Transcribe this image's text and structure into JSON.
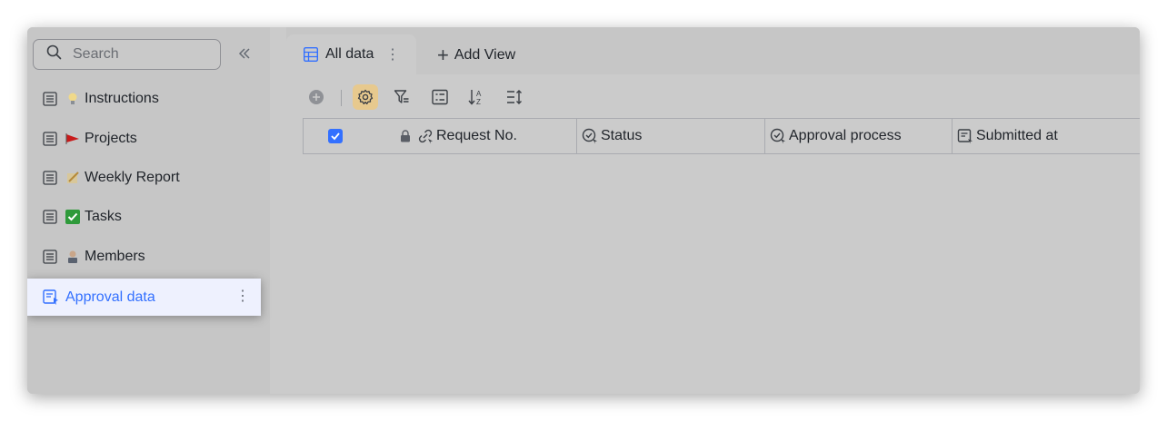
{
  "sidebar": {
    "search": {
      "placeholder": "Search"
    },
    "items": [
      {
        "emoji": "💡",
        "label": "Instructions"
      },
      {
        "emoji": "🚩",
        "label": "Projects"
      },
      {
        "emoji": "📝",
        "label": "Weekly Report"
      },
      {
        "emoji": "✅",
        "label": "Tasks"
      },
      {
        "emoji": "👨‍💻",
        "label": "Members"
      }
    ],
    "active_item": {
      "label": "Approval data"
    }
  },
  "view_tabs": {
    "active_tab": {
      "label": "All data"
    },
    "add_view": {
      "label": "Add View"
    }
  },
  "grid": {
    "columns": [
      {
        "label": "Request No."
      },
      {
        "label": "Status"
      },
      {
        "label": "Approval process"
      },
      {
        "label": "Submitted at"
      }
    ],
    "select_all_checked": true
  },
  "colors": {
    "accent": "#3370ff",
    "active_tool": "#e7c98e"
  },
  "icons": [
    "search-icon",
    "collapse-sidebar-icon",
    "table-icon",
    "approval-table-icon",
    "more-vertical-icon",
    "plus-icon",
    "add-record-icon",
    "settings-icon",
    "filter-icon",
    "group-icon",
    "sort-icon",
    "row-height-icon",
    "lock-icon",
    "link-field-icon",
    "status-field-icon",
    "approval-field-icon",
    "submitted-field-icon",
    "checkbox-icon"
  ]
}
